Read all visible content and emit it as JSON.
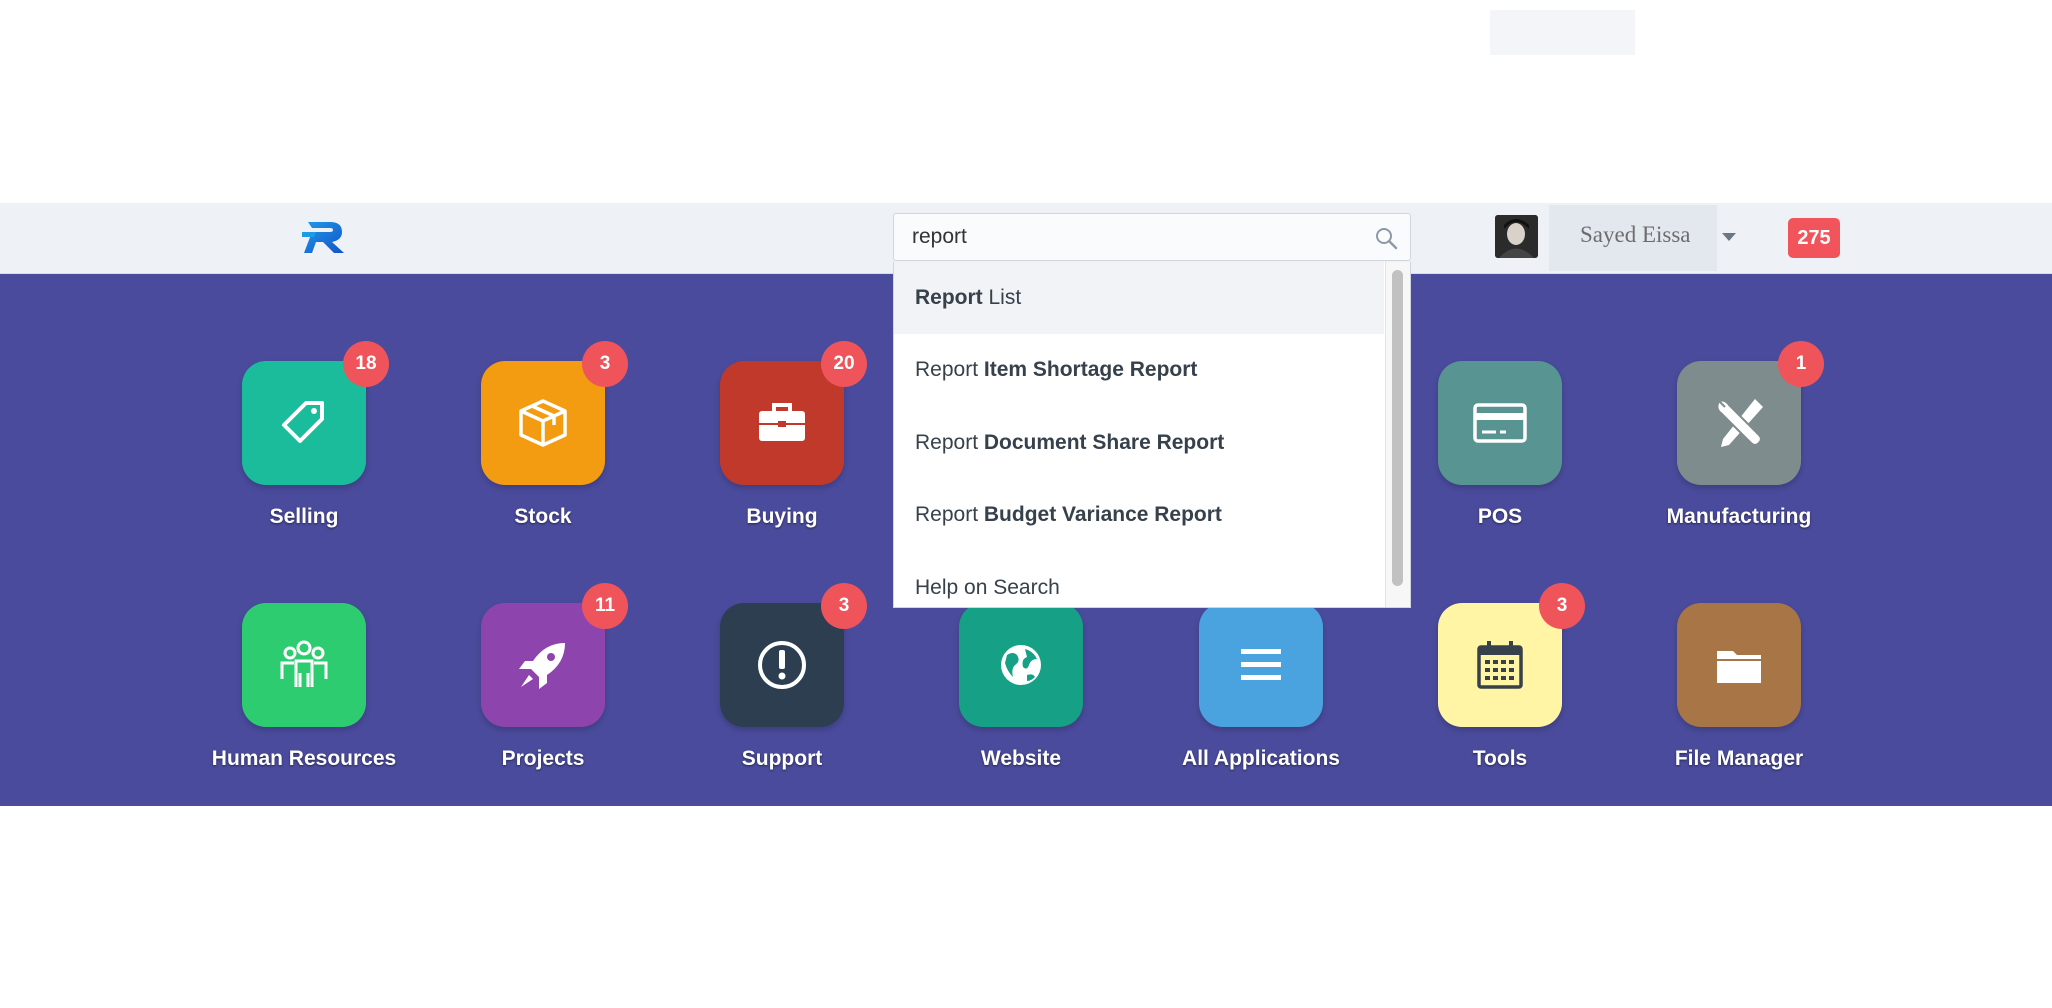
{
  "header": {
    "search": {
      "value": "report",
      "placeholder": ""
    },
    "user": {
      "name": "Sayed Eissa"
    },
    "notifications_count": "275"
  },
  "search_results": [
    {
      "prefix": "",
      "bold": "Report",
      "suffix": " List",
      "active": true
    },
    {
      "prefix": "Report ",
      "bold": "Item Shortage Report",
      "suffix": "",
      "active": false
    },
    {
      "prefix": "Report ",
      "bold": "Document Share Report",
      "suffix": "",
      "active": false
    },
    {
      "prefix": "Report ",
      "bold": "Budget Variance Report",
      "suffix": "",
      "active": false
    },
    {
      "prefix": "Help on Search",
      "bold": "",
      "suffix": "",
      "active": false
    }
  ],
  "apps_row1": [
    {
      "label": "Selling",
      "badge": "18",
      "color": "#1abc9c",
      "icon": "tag-icon"
    },
    {
      "label": "Stock",
      "badge": "3",
      "color": "#f39c12",
      "icon": "box-icon"
    },
    {
      "label": "Buying",
      "badge": "20",
      "color": "#c0392b",
      "icon": "briefcase-icon"
    },
    {
      "label": "POS",
      "badge": "",
      "color": "#589492",
      "icon": "credit-card-icon"
    },
    {
      "label": "Manufacturing",
      "badge": "1",
      "color": "#7f8c8d",
      "icon": "tools-icon"
    }
  ],
  "apps_row2": [
    {
      "label": "Human Resources",
      "badge": "",
      "color": "#2ecc71",
      "icon": "people-icon"
    },
    {
      "label": "Projects",
      "badge": "11",
      "color": "#8e44ad",
      "icon": "rocket-icon"
    },
    {
      "label": "Support",
      "badge": "3",
      "color": "#2c3e50",
      "icon": "exclamation-icon"
    },
    {
      "label": "Website",
      "badge": "",
      "color": "#16a085",
      "icon": "globe-icon"
    },
    {
      "label": "All Applications",
      "badge": "",
      "color": "#4aa3df",
      "icon": "list-icon"
    },
    {
      "label": "Tools",
      "badge": "3",
      "color": "#fff5a5",
      "icon": "calendar-icon"
    },
    {
      "label": "File Manager",
      "badge": "",
      "color": "#a87547",
      "icon": "folder-icon"
    }
  ]
}
